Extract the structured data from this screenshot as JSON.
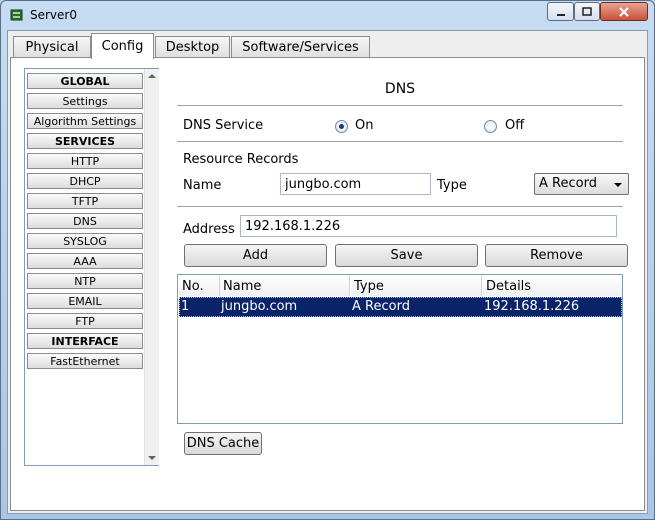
{
  "window": {
    "title": "Server0"
  },
  "tabs": [
    {
      "label": "Physical"
    },
    {
      "label": "Config"
    },
    {
      "label": "Desktop"
    },
    {
      "label": "Software/Services"
    }
  ],
  "sidebar": {
    "items": [
      {
        "label": "GLOBAL",
        "header": true
      },
      {
        "label": "Settings"
      },
      {
        "label": "Algorithm Settings"
      },
      {
        "label": "SERVICES",
        "header": true
      },
      {
        "label": "HTTP"
      },
      {
        "label": "DHCP"
      },
      {
        "label": "TFTP"
      },
      {
        "label": "DNS"
      },
      {
        "label": "SYSLOG"
      },
      {
        "label": "AAA"
      },
      {
        "label": "NTP"
      },
      {
        "label": "EMAIL"
      },
      {
        "label": "FTP"
      },
      {
        "label": "INTERFACE",
        "header": true
      },
      {
        "label": "FastEthernet"
      }
    ]
  },
  "dns": {
    "heading": "DNS",
    "service_label": "DNS Service",
    "on_label": "On",
    "off_label": "Off",
    "service_state": "On",
    "records_label": "Resource Records",
    "name_label": "Name",
    "name_value": "jungbo.com",
    "type_label": "Type",
    "type_value": "A Record",
    "address_label": "Address",
    "address_value": "192.168.1.226",
    "add_label": "Add",
    "save_label": "Save",
    "remove_label": "Remove",
    "cache_label": "DNS Cache"
  },
  "table": {
    "headers": [
      "No.",
      "Name",
      "Type",
      "Details"
    ],
    "rows": [
      [
        "1",
        "jungbo.com",
        "A Record",
        "192.168.1.226"
      ]
    ]
  },
  "colors": {
    "selection": "#0a246a",
    "panel": "#ffffff",
    "chrome": "#b9d1ea"
  }
}
